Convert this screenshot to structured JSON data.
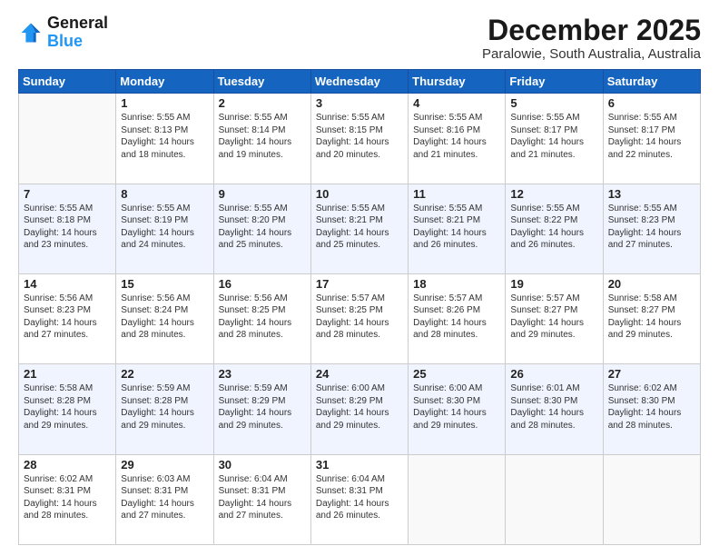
{
  "logo": {
    "line1": "General",
    "line2": "Blue"
  },
  "title": "December 2025",
  "subtitle": "Paralowie, South Australia, Australia",
  "days_header": [
    "Sunday",
    "Monday",
    "Tuesday",
    "Wednesday",
    "Thursday",
    "Friday",
    "Saturday"
  ],
  "weeks": [
    [
      {
        "num": "",
        "empty": true
      },
      {
        "num": "1",
        "sunrise": "5:55 AM",
        "sunset": "8:13 PM",
        "daylight": "14 hours and 18 minutes."
      },
      {
        "num": "2",
        "sunrise": "5:55 AM",
        "sunset": "8:14 PM",
        "daylight": "14 hours and 19 minutes."
      },
      {
        "num": "3",
        "sunrise": "5:55 AM",
        "sunset": "8:15 PM",
        "daylight": "14 hours and 20 minutes."
      },
      {
        "num": "4",
        "sunrise": "5:55 AM",
        "sunset": "8:16 PM",
        "daylight": "14 hours and 21 minutes."
      },
      {
        "num": "5",
        "sunrise": "5:55 AM",
        "sunset": "8:17 PM",
        "daylight": "14 hours and 21 minutes."
      },
      {
        "num": "6",
        "sunrise": "5:55 AM",
        "sunset": "8:17 PM",
        "daylight": "14 hours and 22 minutes."
      }
    ],
    [
      {
        "num": "7",
        "sunrise": "5:55 AM",
        "sunset": "8:18 PM",
        "daylight": "14 hours and 23 minutes."
      },
      {
        "num": "8",
        "sunrise": "5:55 AM",
        "sunset": "8:19 PM",
        "daylight": "14 hours and 24 minutes."
      },
      {
        "num": "9",
        "sunrise": "5:55 AM",
        "sunset": "8:20 PM",
        "daylight": "14 hours and 25 minutes."
      },
      {
        "num": "10",
        "sunrise": "5:55 AM",
        "sunset": "8:21 PM",
        "daylight": "14 hours and 25 minutes."
      },
      {
        "num": "11",
        "sunrise": "5:55 AM",
        "sunset": "8:21 PM",
        "daylight": "14 hours and 26 minutes."
      },
      {
        "num": "12",
        "sunrise": "5:55 AM",
        "sunset": "8:22 PM",
        "daylight": "14 hours and 26 minutes."
      },
      {
        "num": "13",
        "sunrise": "5:55 AM",
        "sunset": "8:23 PM",
        "daylight": "14 hours and 27 minutes."
      }
    ],
    [
      {
        "num": "14",
        "sunrise": "5:56 AM",
        "sunset": "8:23 PM",
        "daylight": "14 hours and 27 minutes."
      },
      {
        "num": "15",
        "sunrise": "5:56 AM",
        "sunset": "8:24 PM",
        "daylight": "14 hours and 28 minutes."
      },
      {
        "num": "16",
        "sunrise": "5:56 AM",
        "sunset": "8:25 PM",
        "daylight": "14 hours and 28 minutes."
      },
      {
        "num": "17",
        "sunrise": "5:57 AM",
        "sunset": "8:25 PM",
        "daylight": "14 hours and 28 minutes."
      },
      {
        "num": "18",
        "sunrise": "5:57 AM",
        "sunset": "8:26 PM",
        "daylight": "14 hours and 28 minutes."
      },
      {
        "num": "19",
        "sunrise": "5:57 AM",
        "sunset": "8:27 PM",
        "daylight": "14 hours and 29 minutes."
      },
      {
        "num": "20",
        "sunrise": "5:58 AM",
        "sunset": "8:27 PM",
        "daylight": "14 hours and 29 minutes."
      }
    ],
    [
      {
        "num": "21",
        "sunrise": "5:58 AM",
        "sunset": "8:28 PM",
        "daylight": "14 hours and 29 minutes."
      },
      {
        "num": "22",
        "sunrise": "5:59 AM",
        "sunset": "8:28 PM",
        "daylight": "14 hours and 29 minutes."
      },
      {
        "num": "23",
        "sunrise": "5:59 AM",
        "sunset": "8:29 PM",
        "daylight": "14 hours and 29 minutes."
      },
      {
        "num": "24",
        "sunrise": "6:00 AM",
        "sunset": "8:29 PM",
        "daylight": "14 hours and 29 minutes."
      },
      {
        "num": "25",
        "sunrise": "6:00 AM",
        "sunset": "8:30 PM",
        "daylight": "14 hours and 29 minutes."
      },
      {
        "num": "26",
        "sunrise": "6:01 AM",
        "sunset": "8:30 PM",
        "daylight": "14 hours and 28 minutes."
      },
      {
        "num": "27",
        "sunrise": "6:02 AM",
        "sunset": "8:30 PM",
        "daylight": "14 hours and 28 minutes."
      }
    ],
    [
      {
        "num": "28",
        "sunrise": "6:02 AM",
        "sunset": "8:31 PM",
        "daylight": "14 hours and 28 minutes."
      },
      {
        "num": "29",
        "sunrise": "6:03 AM",
        "sunset": "8:31 PM",
        "daylight": "14 hours and 27 minutes."
      },
      {
        "num": "30",
        "sunrise": "6:04 AM",
        "sunset": "8:31 PM",
        "daylight": "14 hours and 27 minutes."
      },
      {
        "num": "31",
        "sunrise": "6:04 AM",
        "sunset": "8:31 PM",
        "daylight": "14 hours and 26 minutes."
      },
      {
        "num": "",
        "empty": true
      },
      {
        "num": "",
        "empty": true
      },
      {
        "num": "",
        "empty": true
      }
    ]
  ]
}
